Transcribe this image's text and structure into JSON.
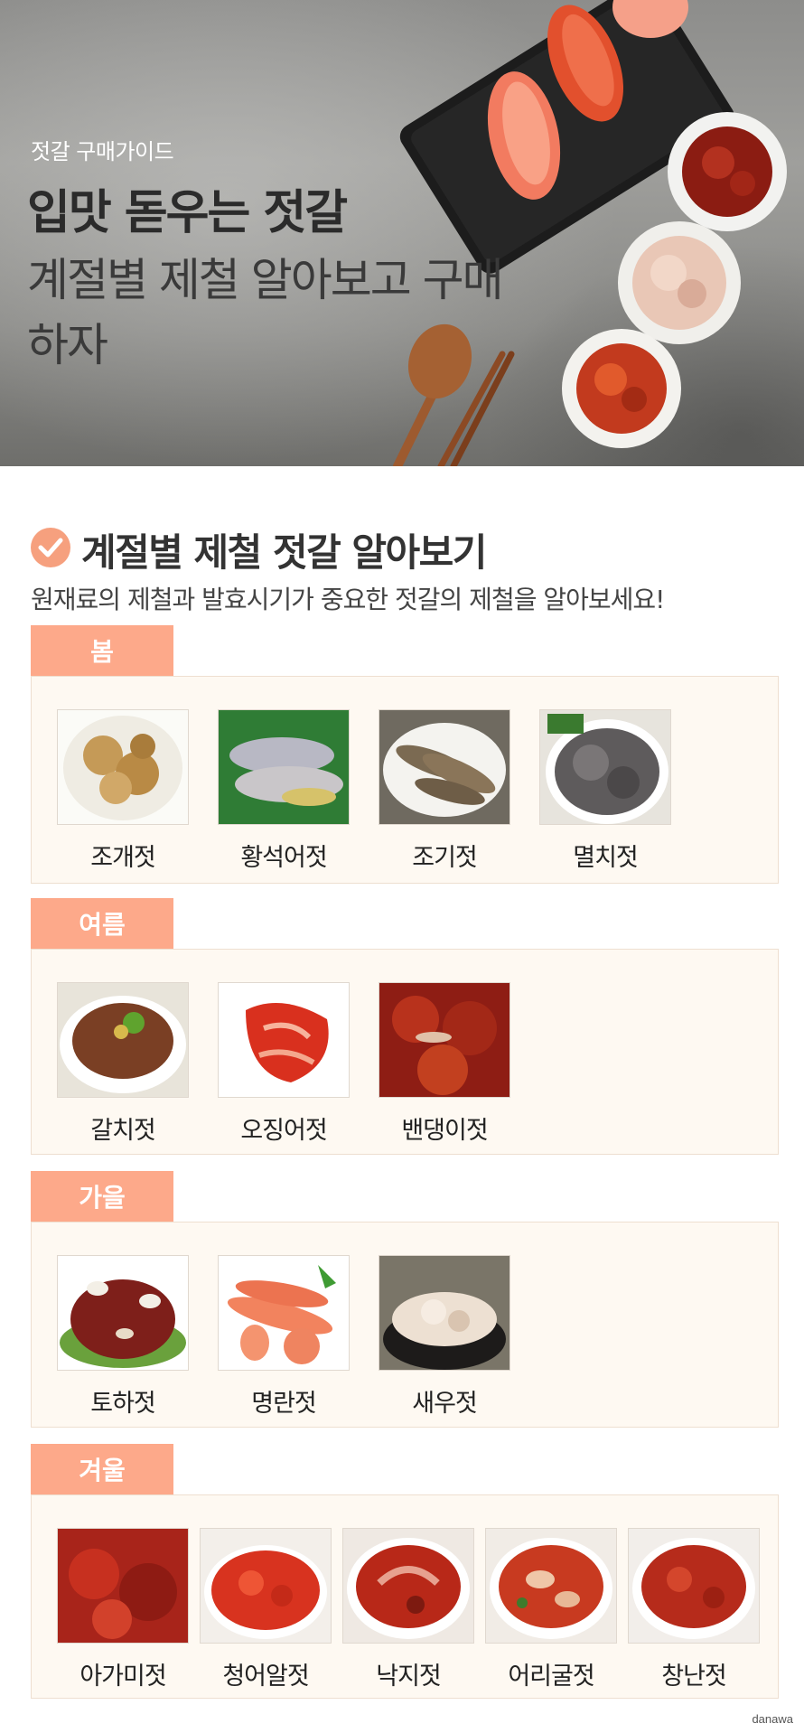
{
  "hero": {
    "eyebrow": "젓갈 구매가이드",
    "title": "입맛 돋우는 젓갈",
    "subtitle": "계절별 제철 알아보고 구매하자"
  },
  "section": {
    "title": "계절별 제철 젓갈 알아보기",
    "description": "원재료의 제철과 발효시기가 중요한 젓갈의 제철을 알아보세요!"
  },
  "seasons": [
    {
      "name": "봄",
      "items": [
        "조개젓",
        "황석어젓",
        "조기젓",
        "멸치젓"
      ]
    },
    {
      "name": "여름",
      "items": [
        "갈치젓",
        "오징어젓",
        "밴댕이젓"
      ]
    },
    {
      "name": "가을",
      "items": [
        "토하젓",
        "명란젓",
        "새우젓"
      ]
    },
    {
      "name": "겨울",
      "items": [
        "아가미젓",
        "청어알젓",
        "낙지젓",
        "어리굴젓",
        "창난젓"
      ]
    }
  ],
  "brand": "danawa",
  "colors": {
    "tab": "#fda98a",
    "box_bg": "#fef9f2",
    "check": "#f6a07e"
  }
}
